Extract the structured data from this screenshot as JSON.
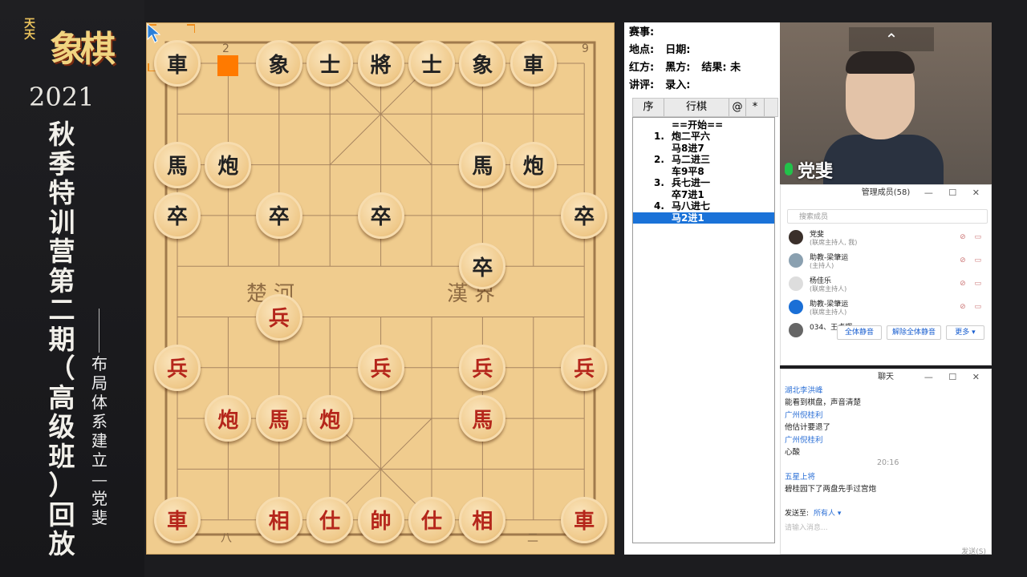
{
  "banner": {
    "logo_small": "天天",
    "logo_main": "象棋",
    "year": "2021",
    "title_chars": [
      "秋",
      "季",
      "特",
      "训",
      "营",
      "第",
      "二",
      "期",
      "（",
      "高",
      "级",
      "班",
      "）",
      "回",
      "放"
    ],
    "subtitle_chars": [
      "布",
      "局",
      "体",
      "系",
      "建",
      "立",
      "—",
      "党",
      "斐"
    ]
  },
  "board": {
    "coord_top_left": "2",
    "coord_top_right": "9",
    "coord_bottom_left": "八",
    "coord_bottom_right": "二",
    "river_left": "楚河",
    "river_right": "漢界",
    "pieces": [
      {
        "ch": "車",
        "side": "black",
        "c": 0,
        "r": 0
      },
      {
        "ch": "象",
        "side": "black",
        "c": 2,
        "r": 0
      },
      {
        "ch": "士",
        "side": "black",
        "c": 3,
        "r": 0
      },
      {
        "ch": "將",
        "side": "black",
        "c": 4,
        "r": 0
      },
      {
        "ch": "士",
        "side": "black",
        "c": 5,
        "r": 0
      },
      {
        "ch": "象",
        "side": "black",
        "c": 6,
        "r": 0
      },
      {
        "ch": "車",
        "side": "black",
        "c": 7,
        "r": 0
      },
      {
        "ch": "馬",
        "side": "black",
        "c": 0,
        "r": 2
      },
      {
        "ch": "炮",
        "side": "black",
        "c": 1,
        "r": 2
      },
      {
        "ch": "馬",
        "side": "black",
        "c": 6,
        "r": 2
      },
      {
        "ch": "炮",
        "side": "black",
        "c": 7,
        "r": 2
      },
      {
        "ch": "卒",
        "side": "black",
        "c": 0,
        "r": 3
      },
      {
        "ch": "卒",
        "side": "black",
        "c": 2,
        "r": 3
      },
      {
        "ch": "卒",
        "side": "black",
        "c": 4,
        "r": 3
      },
      {
        "ch": "卒",
        "side": "black",
        "c": 8,
        "r": 3
      },
      {
        "ch": "卒",
        "side": "black",
        "c": 6,
        "r": 4
      },
      {
        "ch": "兵",
        "side": "red",
        "c": 2,
        "r": 5
      },
      {
        "ch": "兵",
        "side": "red",
        "c": 0,
        "r": 6
      },
      {
        "ch": "兵",
        "side": "red",
        "c": 4,
        "r": 6
      },
      {
        "ch": "兵",
        "side": "red",
        "c": 6,
        "r": 6
      },
      {
        "ch": "兵",
        "side": "red",
        "c": 8,
        "r": 6
      },
      {
        "ch": "炮",
        "side": "red",
        "c": 1,
        "r": 7
      },
      {
        "ch": "馬",
        "side": "red",
        "c": 2,
        "r": 7
      },
      {
        "ch": "炮",
        "side": "red",
        "c": 3,
        "r": 7
      },
      {
        "ch": "馬",
        "side": "red",
        "c": 6,
        "r": 7
      },
      {
        "ch": "車",
        "side": "red",
        "c": 0,
        "r": 9
      },
      {
        "ch": "相",
        "side": "red",
        "c": 2,
        "r": 9
      },
      {
        "ch": "仕",
        "side": "red",
        "c": 3,
        "r": 9
      },
      {
        "ch": "帥",
        "side": "red",
        "c": 4,
        "r": 9
      },
      {
        "ch": "仕",
        "side": "red",
        "c": 5,
        "r": 9
      },
      {
        "ch": "相",
        "side": "red",
        "c": 6,
        "r": 9
      },
      {
        "ch": "車",
        "side": "red",
        "c": 8,
        "r": 9
      }
    ]
  },
  "game_info": {
    "event": "赛事:",
    "location": "地点:",
    "date": "日期:",
    "red": "红方:",
    "black": "黑方:",
    "result": "结果: 未",
    "commentary": "讲评:",
    "recorder": "录入:"
  },
  "move_list": {
    "headers": [
      "序",
      "行棋",
      "@",
      "*"
    ],
    "start": "==开始==",
    "moves": [
      {
        "n": "1.",
        "t": "炮二平六"
      },
      {
        "n": "",
        "t": "马8进7"
      },
      {
        "n": "2.",
        "t": "马二进三"
      },
      {
        "n": "",
        "t": "车9平8"
      },
      {
        "n": "3.",
        "t": "兵七进一"
      },
      {
        "n": "",
        "t": "卒7进1"
      },
      {
        "n": "4.",
        "t": "马八进七"
      },
      {
        "n": "",
        "t": "马2进1",
        "selected": true
      }
    ]
  },
  "video": {
    "presenter_name": "党斐",
    "collapse_icon": "chevron-up-icon"
  },
  "members_panel": {
    "title": "管理成员(58)",
    "search_placeholder": "搜索成员",
    "members": [
      {
        "name": "党斐",
        "role": "(联席主持人, 我)"
      },
      {
        "name": "助教-梁肇运",
        "role": "(主持人)"
      },
      {
        "name": "杨佳乐",
        "role": "(联席主持人)"
      },
      {
        "name": "助教-梁肇运",
        "role": "(联席主持人)"
      },
      {
        "name": "034、王卓辉",
        "role": ""
      }
    ],
    "mute_all": "全体静音",
    "unmute_all": "解除全体静音",
    "more": "更多 ▾"
  },
  "chat_panel": {
    "title": "聊天",
    "messages": [
      {
        "who": "湖北李洪峰",
        "text": "能看到棋盘，声音清楚"
      },
      {
        "who": "广州倪桂利",
        "text": "他估计要退了"
      },
      {
        "who": "广州倪桂利",
        "text": "心酸"
      }
    ],
    "time": "20:16",
    "last_who": "五星上将",
    "last_text": "碧桂园下了两盘先手过宫炮",
    "send_to_label": "发送至:",
    "send_to_value": "所有人 ▾",
    "input_placeholder": "请输入消息...",
    "send_button": "发送(S)"
  }
}
